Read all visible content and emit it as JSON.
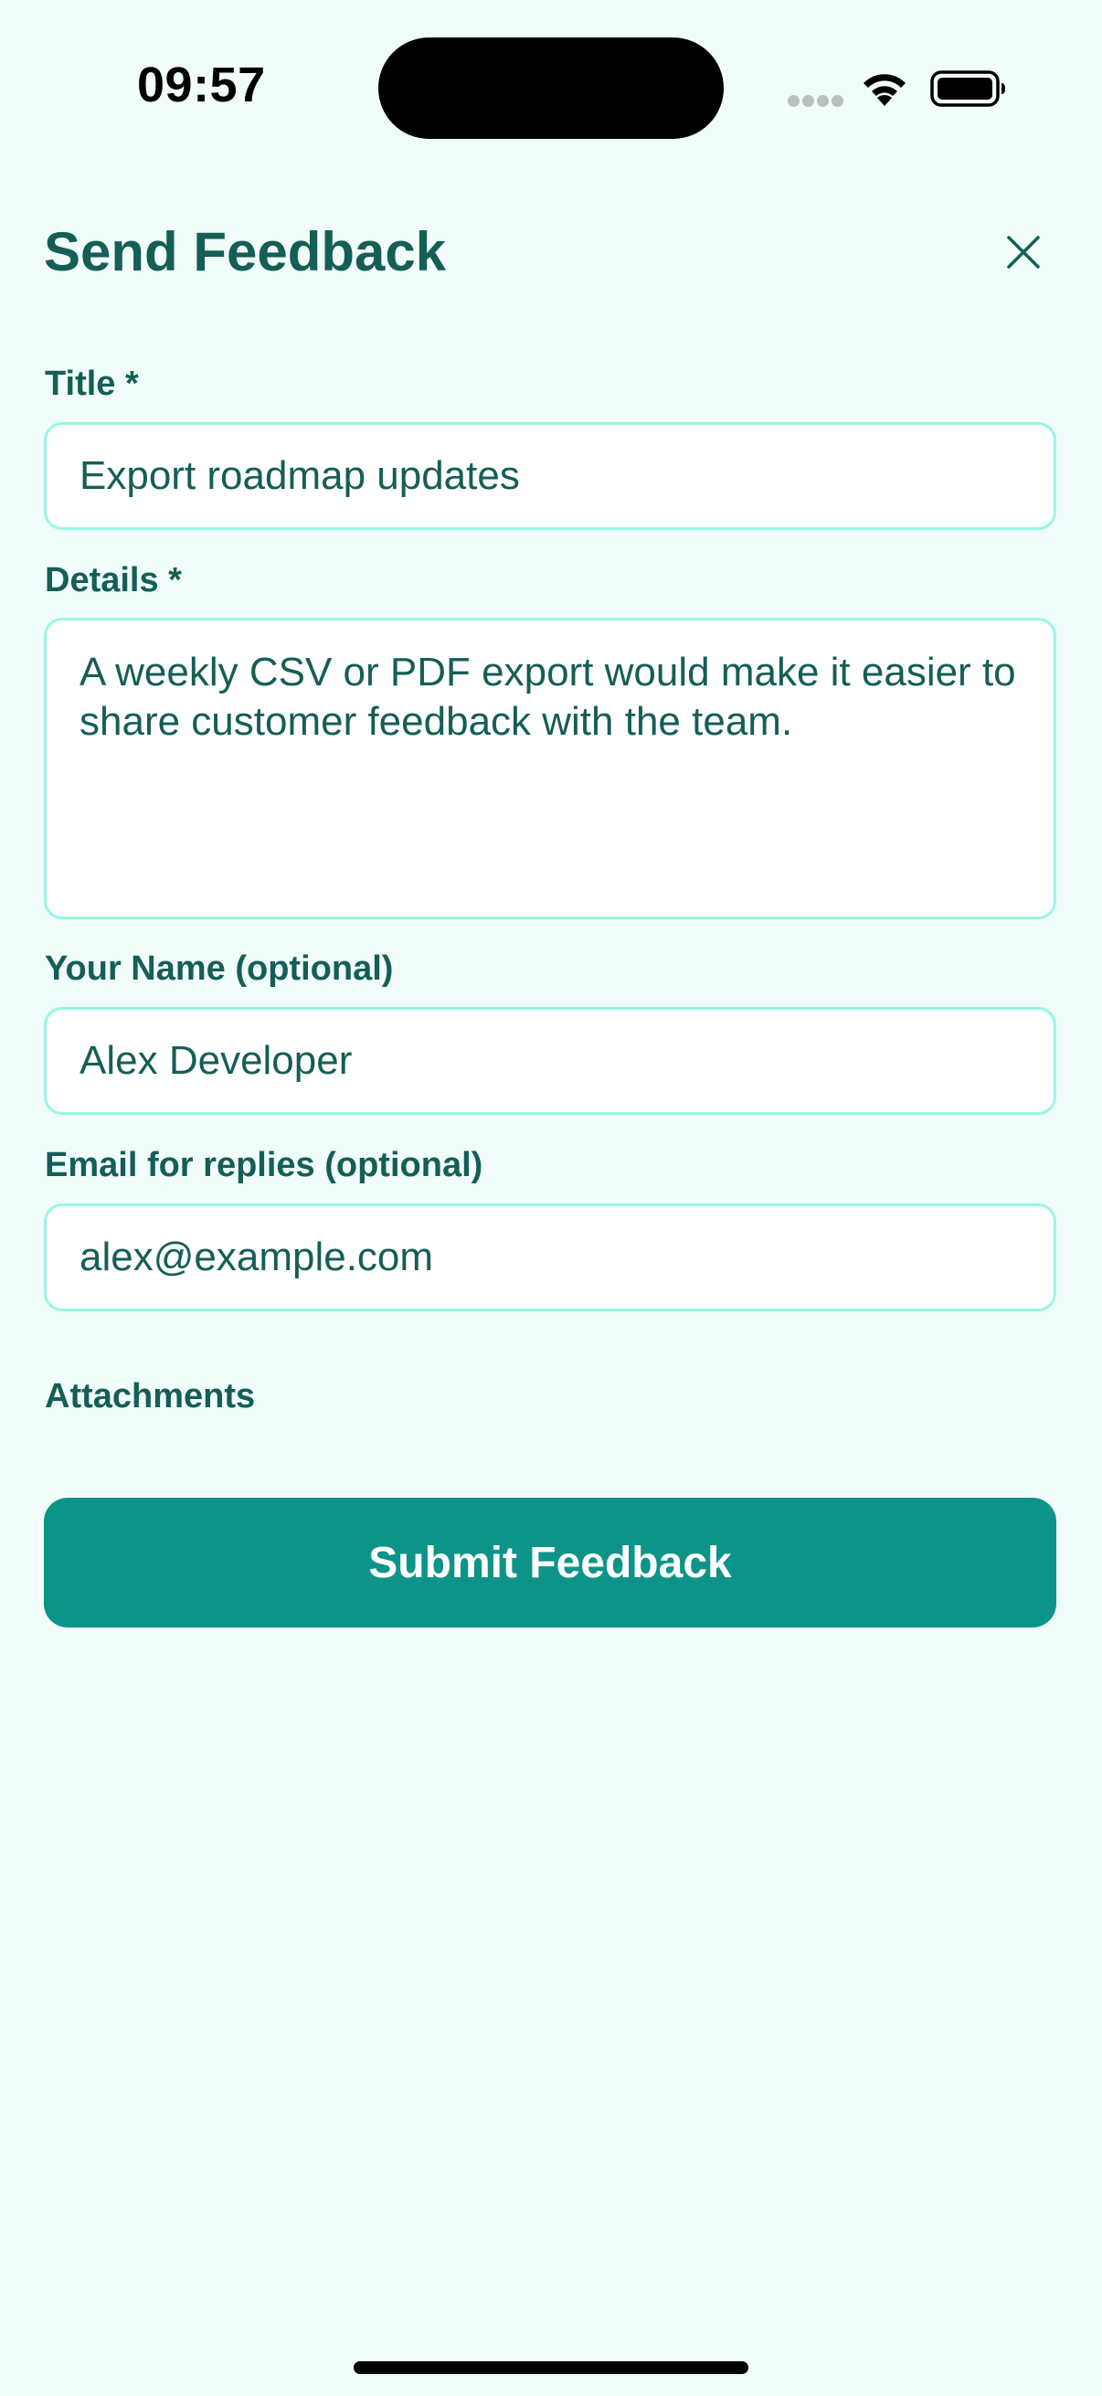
{
  "status_bar": {
    "time": "09:57"
  },
  "header": {
    "title": "Send Feedback",
    "close_icon": "close-icon"
  },
  "form": {
    "title_field": {
      "label": "Title *",
      "value": "Export roadmap updates"
    },
    "details_field": {
      "label": "Details *",
      "value": "A weekly CSV or PDF export would make it easier to share customer feedback with the team."
    },
    "name_field": {
      "label": "Your Name (optional)",
      "value": "Alex Developer"
    },
    "email_field": {
      "label": "Email for replies (optional)",
      "value": "alex@example.com"
    },
    "attachments_label": "Attachments",
    "submit_label": "Submit Feedback"
  },
  "colors": {
    "background": "#f0fdfa",
    "text": "#155e57",
    "field_border": "#99f6e4",
    "button": "#0d9488"
  }
}
